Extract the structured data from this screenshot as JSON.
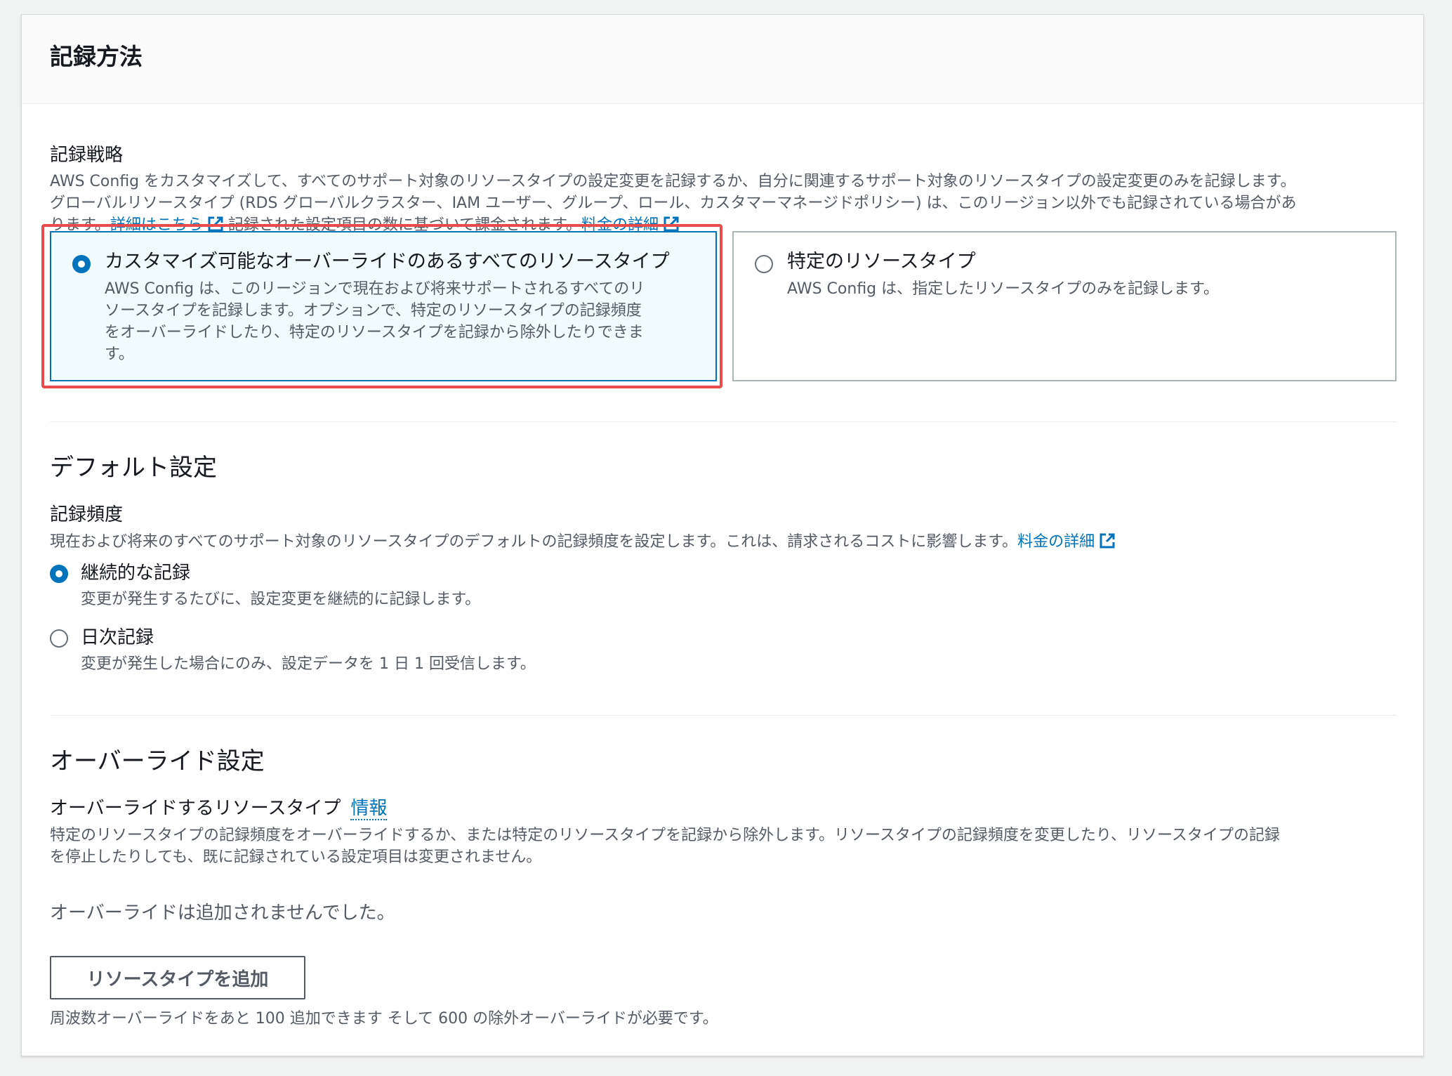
{
  "header": {
    "title": "記録方法"
  },
  "strategy": {
    "label": "記録戦略",
    "desc_line1": "AWS Config をカスタマイズして、すべてのサポート対象のリソースタイプの設定変更を記録するか、自分に関連するサポート対象のリソースタイプの設定変更のみを記録します。",
    "desc_line2": "グローバルリソースタイプ (RDS グローバルクラスター、IAM ユーザー、グループ、ロール、カスタマーマネージドポリシー) は、このリージョン以外でも記録されている場合があ",
    "desc_line3_prefix": "ります。",
    "learn_more_link": "詳細はこちら",
    "desc_line3_middle": "記録された設定項目の数に基づいて課金されます。",
    "pricing_link": "料金の詳細",
    "options": [
      {
        "title": "カスタマイズ可能なオーバーライドのあるすべてのリソースタイプ",
        "desc_lines": [
          "AWS Config は、このリージョンで現在および将来サポートされるすべてのリ",
          "ソースタイプを記録します。オプションで、特定のリソースタイプの記録頻度",
          "をオーバーライドしたり、特定のリソースタイプを記録から除外したりできま",
          "す。"
        ],
        "selected": true
      },
      {
        "title": "特定のリソースタイプ",
        "desc_lines": [
          "AWS Config は、指定したリソースタイプのみを記録します。"
        ],
        "selected": false
      }
    ]
  },
  "default_settings": {
    "title": "デフォルト設定",
    "frequency_label": "記録頻度",
    "frequency_desc": "現在および将来のすべてのサポート対象のリソースタイプのデフォルトの記録頻度を設定します。これは、請求されるコストに影響します。",
    "pricing_link": "料金の詳細",
    "options": [
      {
        "label": "継続的な記録",
        "desc": "変更が発生するたびに、設定変更を継続的に記録します。",
        "selected": true
      },
      {
        "label": "日次記録",
        "desc": "変更が発生した場合にのみ、設定データを 1 日 1 回受信します。",
        "selected": false
      }
    ]
  },
  "override_settings": {
    "title": "オーバーライド設定",
    "resource_types_label": "オーバーライドするリソースタイプ",
    "info_link": "情報",
    "desc_line1": "特定のリソースタイプの記録頻度をオーバーライドするか、または特定のリソースタイプを記録から除外します。リソースタイプの記録頻度を変更したり、リソースタイプの記録",
    "desc_line2": "を停止したりしても、既に記録されている設定項目は変更されません。",
    "empty_text": "オーバーライドは追加されませんでした。",
    "add_button": "リソースタイプを追加",
    "footer_note": "周波数オーバーライドをあと 100 追加できます そして 600 の除外オーバーライドが必要です。"
  },
  "colors": {
    "link": "#0073bb",
    "selected_border": "#0073bb",
    "selected_bg": "#f1faff",
    "highlight": "#e84b4b",
    "text": "#16191f",
    "secondary_text": "#545b64"
  },
  "icons": {
    "external_link": "external-link-icon",
    "radio_checked": "radio-checked-icon",
    "radio_unchecked": "radio-unchecked-icon"
  }
}
